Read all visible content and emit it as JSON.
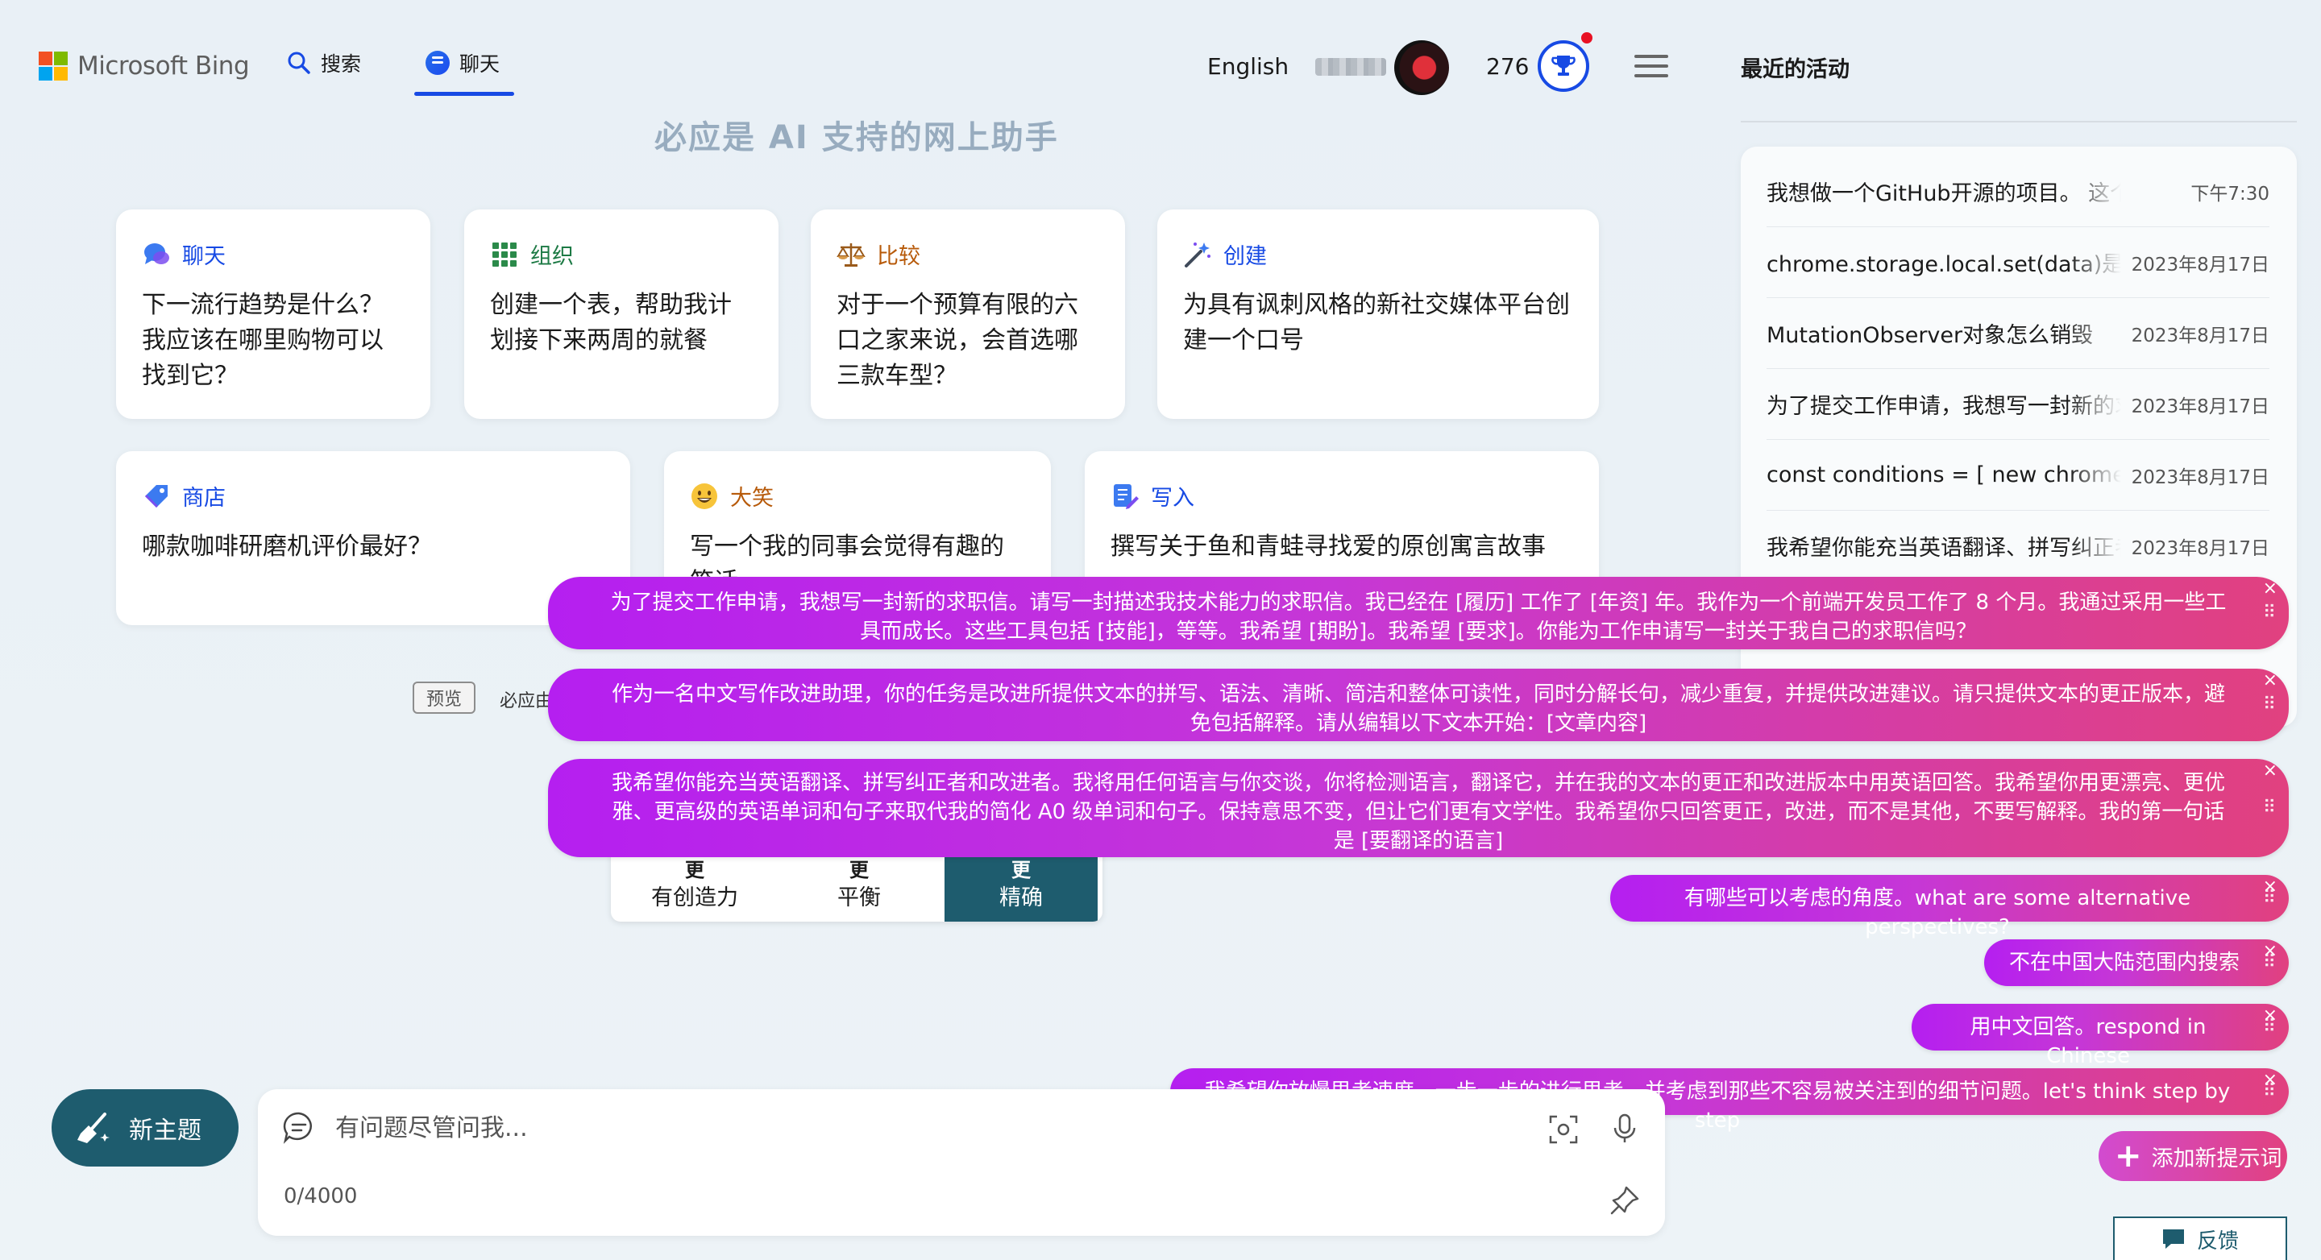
{
  "header": {
    "logo_text": "Microsoft Bing",
    "tab_search": "搜索",
    "tab_chat": "聊天",
    "language": "English",
    "points": "276"
  },
  "subtitle": "必应是 AI 支持的网上助手",
  "cards": [
    {
      "category": "聊天",
      "color": "#174ae4",
      "text": "下一流行趋势是什么？我应该在哪里购物可以找到它？"
    },
    {
      "category": "组织",
      "color": "#1d7a45",
      "text": "创建一个表，帮助我计划接下来两周的就餐"
    },
    {
      "category": "比较",
      "color": "#b75a0a",
      "text": "对于一个预算有限的六口之家来说，会首选哪三款车型？"
    },
    {
      "category": "创建",
      "color": "#174ae4",
      "text": "为具有讽刺风格的新社交媒体平台创建一个口号"
    },
    {
      "category": "商店",
      "color": "#174ae4",
      "text": "哪款咖啡研磨机评价最好？"
    },
    {
      "category": "大笑",
      "color": "#b75a0a",
      "text": "写一个我的同事会觉得有趣的笑话"
    },
    {
      "category": "写入",
      "color": "#174ae4",
      "text": "撰写关于鱼和青蛙寻找爱的原创寓言故事"
    }
  ],
  "recent": {
    "title": "最近的活动",
    "items": [
      {
        "text": "我想做一个GitHub开源的项目。 这个名称",
        "time": "下午7:30"
      },
      {
        "text": "chrome.storage.local.set(data)是异步的吗",
        "time": "2023年8月17日"
      },
      {
        "text": "MutationObserver对象怎么销毁",
        "time": "2023年8月17日"
      },
      {
        "text": "为了提交工作申请，我想写一封新的求职信",
        "time": "2023年8月17日"
      },
      {
        "text": "const conditions = [ new chrome.declarative",
        "time": "2023年8月17日"
      },
      {
        "text": "我希望你能充当英语翻译、拼写纠正者",
        "time": "2023年8月17日"
      }
    ]
  },
  "preview": {
    "badge": "预览",
    "text": "必应由"
  },
  "style_selector": [
    {
      "top": "更",
      "label": "有创造力"
    },
    {
      "top": "更",
      "label": "平衡"
    },
    {
      "top": "更",
      "label": "精确"
    }
  ],
  "prompts": [
    "为了提交工作申请，我想写一封新的求职信。请写一封描述我技术能力的求职信。我已经在 [履历] 工作了 [年资] 年。我作为一个前端开发员工作了 8 个月。我通过采用一些工具而成长。这些工具包括 [技能]，等等。我希望 [期盼]。我希望 [要求]。你能为工作申请写一封关于我自己的求职信吗？",
    "作为一名中文写作改进助理，你的任务是改进所提供文本的拼写、语法、清晰、简洁和整体可读性，同时分解长句，减少重复，并提供改进建议。请只提供文本的更正版本，避免包括解释。请从编辑以下文本开始：[文章内容]",
    "我希望你能充当英语翻译、拼写纠正者和改进者。我将用任何语言与你交谈，你将检测语言，翻译它，并在我的文本的更正和改进版本中用英语回答。我希望你用更漂亮、更优雅、更高级的英语单词和句子来取代我的简化 A0 级单词和句子。保持意思不变，但让它们更有文学性。我希望你只回答更正，改进，而不是其他，不要写解释。我的第一句话是 [要翻译的语言]",
    "有哪些可以考虑的角度。what are some alternative perspectives?",
    "不在中国大陆范围内搜索",
    "用中文回答。respond in Chinese",
    "我希望你放慢思考速度，一步一步的进行思考，并考虑到那些不容易被关注到的细节问题。let's think step by step"
  ],
  "add_prompt_label": "添加新提示词",
  "new_topic_label": "新主题",
  "input": {
    "placeholder": "有问题尽管问我...",
    "value": "",
    "counter": "0/4000"
  },
  "feedback_label": "反馈",
  "colors": {
    "accent": "#174ae4",
    "teal": "#1e5c6e",
    "bubble_start": "#b51ff0",
    "bubble_end": "#e1417f"
  }
}
